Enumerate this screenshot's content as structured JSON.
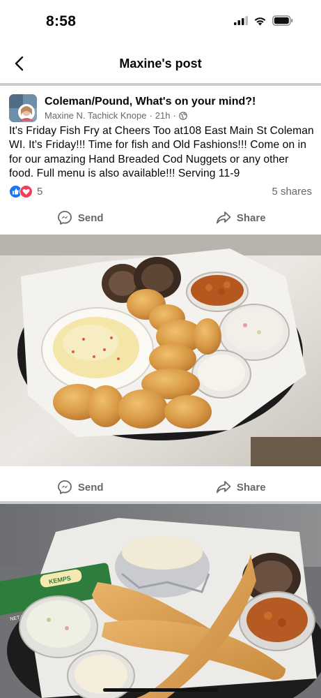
{
  "status_bar": {
    "time": "8:58"
  },
  "nav": {
    "title": "Maxine's post"
  },
  "post": {
    "group_name": "Coleman/Pound, What's on your mind?!",
    "author": "Maxine N. Tachick Knope",
    "separator": "·",
    "time": "21h",
    "separator2": "·",
    "text": "It's Friday Fish Fry at Cheers Too at108 East Main St Coleman WI. It's Friday!!! Time for fish and Old Fashions!!! Come on in for our amazing Hand Breaded Cod Nuggets or any other food. Full menu is also available!!! Serving 11-9",
    "reaction_count": "5",
    "shares": "5 shares"
  },
  "actions": {
    "send_label": "Send",
    "share_label": "Share"
  },
  "photo2": {
    "package_text": "KEMPS",
    "net_wt": "NET WT 1 OZ"
  },
  "colors": {
    "facebook_blue": "#1877f2",
    "love_red": "#f33e58",
    "divider": "#c9ccd1",
    "secondary_text": "#65676b"
  }
}
